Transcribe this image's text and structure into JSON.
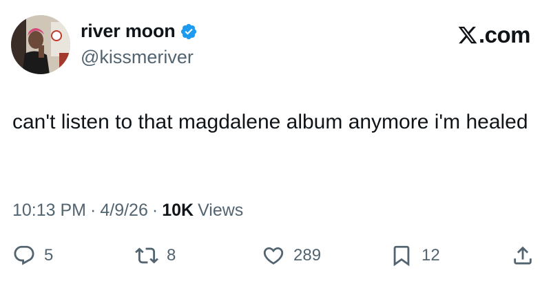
{
  "author": {
    "display_name": "river moon",
    "handle": "@kissmeriver",
    "verified_icon": "verified-badge-icon",
    "verified_color": "#1d9bf0"
  },
  "brand": {
    "label": ".com",
    "icon": "x-logo-icon"
  },
  "tweet": {
    "text": "can't listen to that magdalene album anymore i'm healed"
  },
  "meta": {
    "time": "10:13 PM",
    "separator": "·",
    "date": "4/9/26",
    "views_count": "10K",
    "views_label": "Views"
  },
  "actions": {
    "replies": "5",
    "reposts": "8",
    "likes": "289",
    "bookmarks": "12"
  },
  "colors": {
    "text": "#0f1419",
    "secondary": "#536471",
    "accent": "#1d9bf0"
  }
}
